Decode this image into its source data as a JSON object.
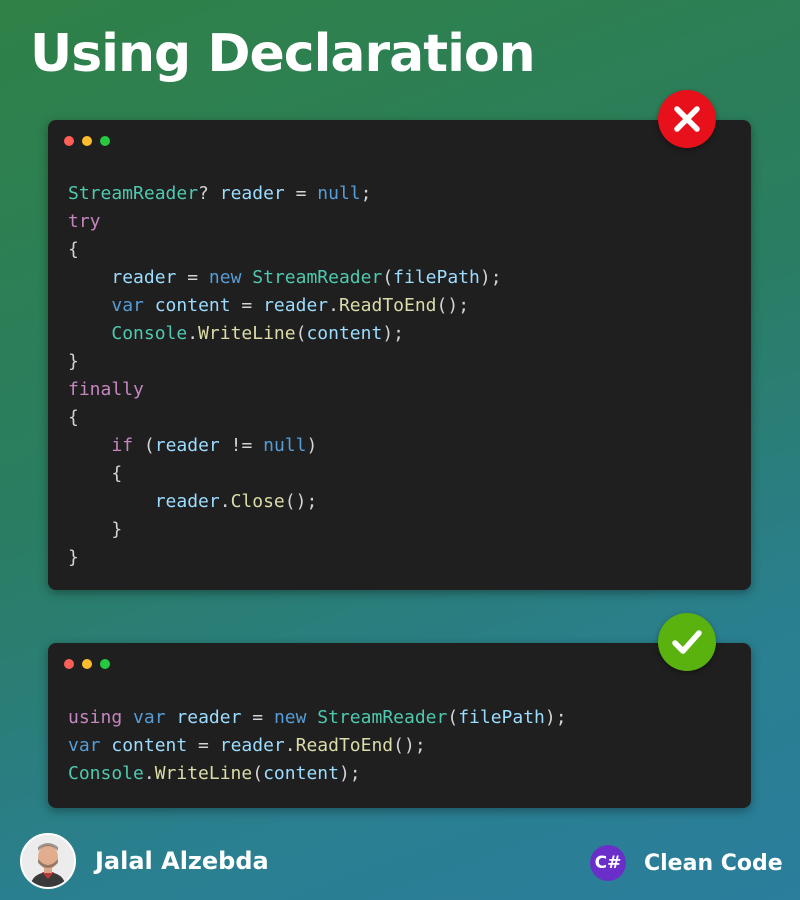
{
  "title": "Using Declaration",
  "window_dot_colors": [
    "#ff5f56",
    "#ffbd2e",
    "#27c93f"
  ],
  "token_colors": {
    "keyword": "#569cd6",
    "control": "#c586c0",
    "type": "#4ec9b0",
    "variable": "#9cdcfe",
    "method": "#dcdcaa",
    "punctuation": "#d4d4d4"
  },
  "bad_example": {
    "status": "incorrect",
    "badge_icon": "cross-icon",
    "badge_color": "#e8101a",
    "lines": [
      {
        "indent": "",
        "tokens": [
          [
            "StreamReader",
            "type"
          ],
          [
            "? ",
            "punc"
          ],
          [
            "reader",
            "var"
          ],
          [
            " = ",
            "punc"
          ],
          [
            "null",
            "kw"
          ],
          [
            ";",
            "punc"
          ]
        ]
      },
      {
        "indent": "",
        "tokens": [
          [
            "try",
            "ctrl"
          ]
        ]
      },
      {
        "indent": "",
        "tokens": [
          [
            "{",
            "punc"
          ]
        ]
      },
      {
        "indent": "    ",
        "tokens": [
          [
            "reader",
            "var"
          ],
          [
            " = ",
            "punc"
          ],
          [
            "new",
            "kw"
          ],
          [
            " ",
            "punc"
          ],
          [
            "StreamReader",
            "type"
          ],
          [
            "(",
            "punc"
          ],
          [
            "filePath",
            "var"
          ],
          [
            ");",
            "punc"
          ]
        ]
      },
      {
        "indent": "    ",
        "tokens": [
          [
            "var",
            "kw"
          ],
          [
            " ",
            "punc"
          ],
          [
            "content",
            "var"
          ],
          [
            " = ",
            "punc"
          ],
          [
            "reader",
            "var"
          ],
          [
            ".",
            "punc"
          ],
          [
            "ReadToEnd",
            "method"
          ],
          [
            "();",
            "punc"
          ]
        ]
      },
      {
        "indent": "    ",
        "tokens": [
          [
            "Console",
            "type"
          ],
          [
            ".",
            "punc"
          ],
          [
            "WriteLine",
            "method"
          ],
          [
            "(",
            "punc"
          ],
          [
            "content",
            "var"
          ],
          [
            ");",
            "punc"
          ]
        ]
      },
      {
        "indent": "",
        "tokens": [
          [
            "}",
            "punc"
          ]
        ]
      },
      {
        "indent": "",
        "tokens": [
          [
            "finally",
            "ctrl"
          ]
        ]
      },
      {
        "indent": "",
        "tokens": [
          [
            "{",
            "punc"
          ]
        ]
      },
      {
        "indent": "    ",
        "tokens": [
          [
            "if",
            "ctrl"
          ],
          [
            " (",
            "punc"
          ],
          [
            "reader",
            "var"
          ],
          [
            " != ",
            "punc"
          ],
          [
            "null",
            "kw"
          ],
          [
            ")",
            "punc"
          ]
        ]
      },
      {
        "indent": "    ",
        "tokens": [
          [
            "{",
            "punc"
          ]
        ]
      },
      {
        "indent": "        ",
        "tokens": [
          [
            "reader",
            "var"
          ],
          [
            ".",
            "punc"
          ],
          [
            "Close",
            "method"
          ],
          [
            "();",
            "punc"
          ]
        ]
      },
      {
        "indent": "    ",
        "tokens": [
          [
            "}",
            "punc"
          ]
        ]
      },
      {
        "indent": "",
        "tokens": [
          [
            "}",
            "punc"
          ]
        ]
      }
    ]
  },
  "good_example": {
    "status": "correct",
    "badge_icon": "check-icon",
    "badge_color": "#5ab20f",
    "lines": [
      {
        "indent": "",
        "tokens": [
          [
            "using",
            "ctrl"
          ],
          [
            " ",
            "punc"
          ],
          [
            "var",
            "kw"
          ],
          [
            " ",
            "punc"
          ],
          [
            "reader",
            "var"
          ],
          [
            " = ",
            "punc"
          ],
          [
            "new",
            "kw"
          ],
          [
            " ",
            "punc"
          ],
          [
            "StreamReader",
            "type"
          ],
          [
            "(",
            "punc"
          ],
          [
            "filePath",
            "var"
          ],
          [
            ");",
            "punc"
          ]
        ]
      },
      {
        "indent": "",
        "tokens": [
          [
            "var",
            "kw"
          ],
          [
            " ",
            "punc"
          ],
          [
            "content",
            "var"
          ],
          [
            " = ",
            "punc"
          ],
          [
            "reader",
            "var"
          ],
          [
            ".",
            "punc"
          ],
          [
            "ReadToEnd",
            "method"
          ],
          [
            "();",
            "punc"
          ]
        ]
      },
      {
        "indent": "",
        "tokens": [
          [
            "Console",
            "type"
          ],
          [
            ".",
            "punc"
          ],
          [
            "WriteLine",
            "method"
          ],
          [
            "(",
            "punc"
          ],
          [
            "content",
            "var"
          ],
          [
            ");",
            "punc"
          ]
        ]
      }
    ]
  },
  "footer": {
    "author_name": "Jalal Alzebda",
    "avatar_icon": "author-portrait",
    "brand_logo_text": "C#",
    "brand_name": "Clean Code"
  }
}
